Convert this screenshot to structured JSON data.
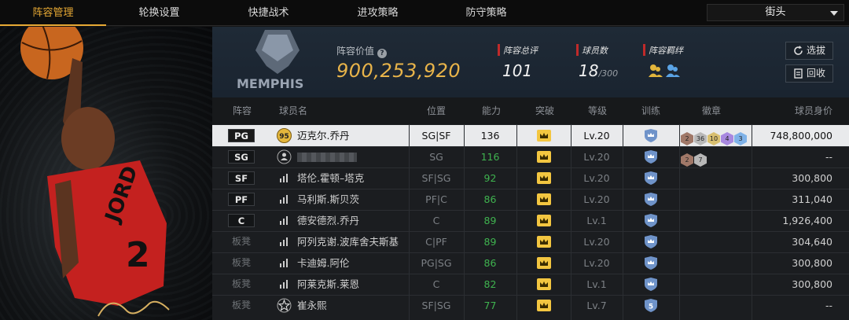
{
  "nav": {
    "tabs": [
      {
        "label": "阵容管理",
        "active": true
      },
      {
        "label": "轮换设置",
        "active": false
      },
      {
        "label": "快捷战术",
        "active": false
      },
      {
        "label": "进攻策略",
        "active": false
      },
      {
        "label": "防守策略",
        "active": false
      }
    ],
    "mode_select": "街头"
  },
  "header": {
    "team_logo_text": "MEMPHIS",
    "lineup_value_label": "阵容价值",
    "lineup_value": "900,253,920",
    "total_rating_label": "阵容总评",
    "total_rating": "101",
    "player_count_label": "球员数",
    "player_count": "18",
    "player_count_max": "/300",
    "bond_label": "阵容羁绊",
    "buttons": {
      "select": "选拔",
      "recycle": "回收"
    }
  },
  "table": {
    "columns": [
      "阵容",
      "球员名",
      "位置",
      "能力",
      "突破",
      "等级",
      "训练",
      "徽章",
      "球员身价"
    ],
    "rows": [
      {
        "slot": "PG",
        "bench": false,
        "icon": "rating-95",
        "icon_text": "95",
        "name": "迈克尔.乔丹",
        "position": "SG|SF",
        "ability": "136",
        "level": "Lv.20",
        "training": "",
        "badges": [
          "2",
          "36",
          "10",
          "4",
          "3"
        ],
        "value": "748,800,000",
        "selected": true
      },
      {
        "slot": "SG",
        "bench": false,
        "icon": "person-icon",
        "name": "",
        "name_blurred": true,
        "position": "SG",
        "ability": "116",
        "level": "Lv.20",
        "training": "",
        "badges": [
          "2",
          "7"
        ],
        "value": "--",
        "selected": false
      },
      {
        "slot": "SF",
        "bench": false,
        "icon": "bars-icon",
        "name": "塔伦.霍顿–塔克",
        "position": "SF|SG",
        "ability": "92",
        "level": "Lv.20",
        "training": "",
        "badges": [],
        "value": "300,800",
        "selected": false
      },
      {
        "slot": "PF",
        "bench": false,
        "icon": "bars-icon",
        "name": "马利斯.斯贝茨",
        "position": "PF|C",
        "ability": "86",
        "level": "Lv.20",
        "training": "",
        "badges": [],
        "value": "311,040",
        "selected": false
      },
      {
        "slot": "C",
        "bench": false,
        "icon": "bars-icon",
        "name": "德安德烈.乔丹",
        "position": "C",
        "ability": "89",
        "level": "Lv.1",
        "training": "",
        "badges": [],
        "value": "1,926,400",
        "selected": false
      },
      {
        "slot": "板凳",
        "bench": true,
        "icon": "bars-icon",
        "name": "阿列克谢.波库舍夫斯基",
        "position": "C|PF",
        "ability": "89",
        "level": "Lv.20",
        "training": "",
        "badges": [],
        "value": "304,640",
        "selected": false
      },
      {
        "slot": "板凳",
        "bench": true,
        "icon": "bars-icon",
        "name": "卡迪姆.阿伦",
        "position": "PG|SG",
        "ability": "86",
        "level": "Lv.20",
        "training": "",
        "badges": [],
        "value": "300,800",
        "selected": false
      },
      {
        "slot": "板凳",
        "bench": true,
        "icon": "bars-icon",
        "name": "阿莱克斯.莱恩",
        "position": "C",
        "ability": "82",
        "level": "Lv.1",
        "training": "",
        "badges": [],
        "value": "300,800",
        "selected": false
      },
      {
        "slot": "板凳",
        "bench": true,
        "icon": "star-icon",
        "name": "崔永熙",
        "position": "SF|SG",
        "ability": "77",
        "level": "Lv.7",
        "training": "5",
        "badges": [],
        "value": "--",
        "selected": false
      }
    ]
  },
  "colors": {
    "accent": "#e7a934",
    "ability_green": "#3fb34f",
    "ability_white": "#111111",
    "crown_yellow": "#f3c640",
    "shield_blue": "#6f93c9",
    "stat_marker_red": "#c02a2a"
  },
  "badge_colors": [
    "#a07868",
    "#b8b8b8",
    "#d8bf70",
    "#a888e0",
    "#7fb2e8"
  ]
}
